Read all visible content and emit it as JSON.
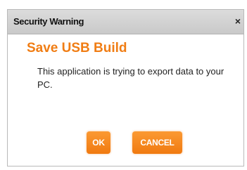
{
  "dialog": {
    "title": "Security Warning",
    "close_symbol": "×",
    "heading": "Save USB Build",
    "message": "This application is trying to export data to your PC.",
    "buttons": {
      "ok_label": "OK",
      "cancel_label": "CANCEL"
    }
  },
  "colors": {
    "accent": "#f07d14",
    "titlebar": "#d3d3d3"
  },
  "icons": {
    "close": "close-icon"
  }
}
